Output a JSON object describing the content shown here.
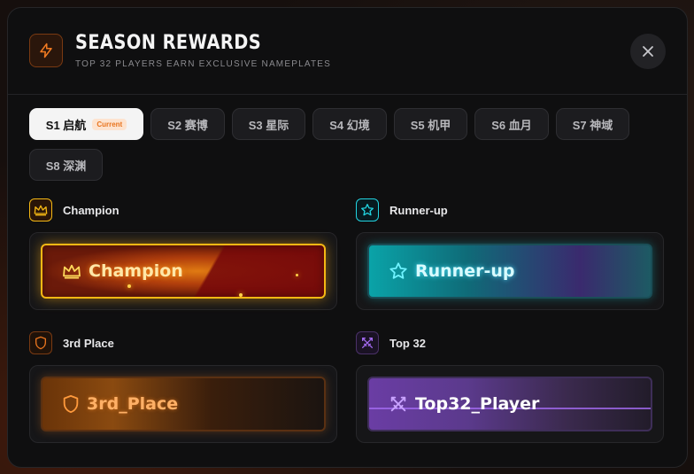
{
  "header": {
    "title": "SEASON REWARDS",
    "subtitle": "TOP 32 PLAYERS EARN EXCLUSIVE NAMEPLATES",
    "icon": "lightning-icon",
    "close_icon": "close-icon"
  },
  "tabs": [
    {
      "label": "S1 启航",
      "badge": "Current",
      "active": true
    },
    {
      "label": "S2 赛博",
      "active": false
    },
    {
      "label": "S3 星际",
      "active": false
    },
    {
      "label": "S4 幻境",
      "active": false
    },
    {
      "label": "S5 机甲",
      "active": false
    },
    {
      "label": "S6 血月",
      "active": false
    },
    {
      "label": "S7 神域",
      "active": false
    },
    {
      "label": "S8 深渊",
      "active": false
    }
  ],
  "rewards": {
    "champion": {
      "label": "Champion",
      "icon": "crown-icon",
      "nameplate": "Champion",
      "color": "#f5b814"
    },
    "runner_up": {
      "label": "Runner-up",
      "icon": "star-icon",
      "nameplate": "Runner-up",
      "color": "#22d3e0"
    },
    "third": {
      "label": "3rd Place",
      "icon": "shield-icon",
      "nameplate": "3rd_Place",
      "color": "#e8741e"
    },
    "top32": {
      "label": "Top 32",
      "icon": "crossed-swords-icon",
      "nameplate": "Top32_Player",
      "color": "#a36af0"
    }
  },
  "colors": {
    "accent": "#e8741e",
    "background": "#0f0f10"
  }
}
